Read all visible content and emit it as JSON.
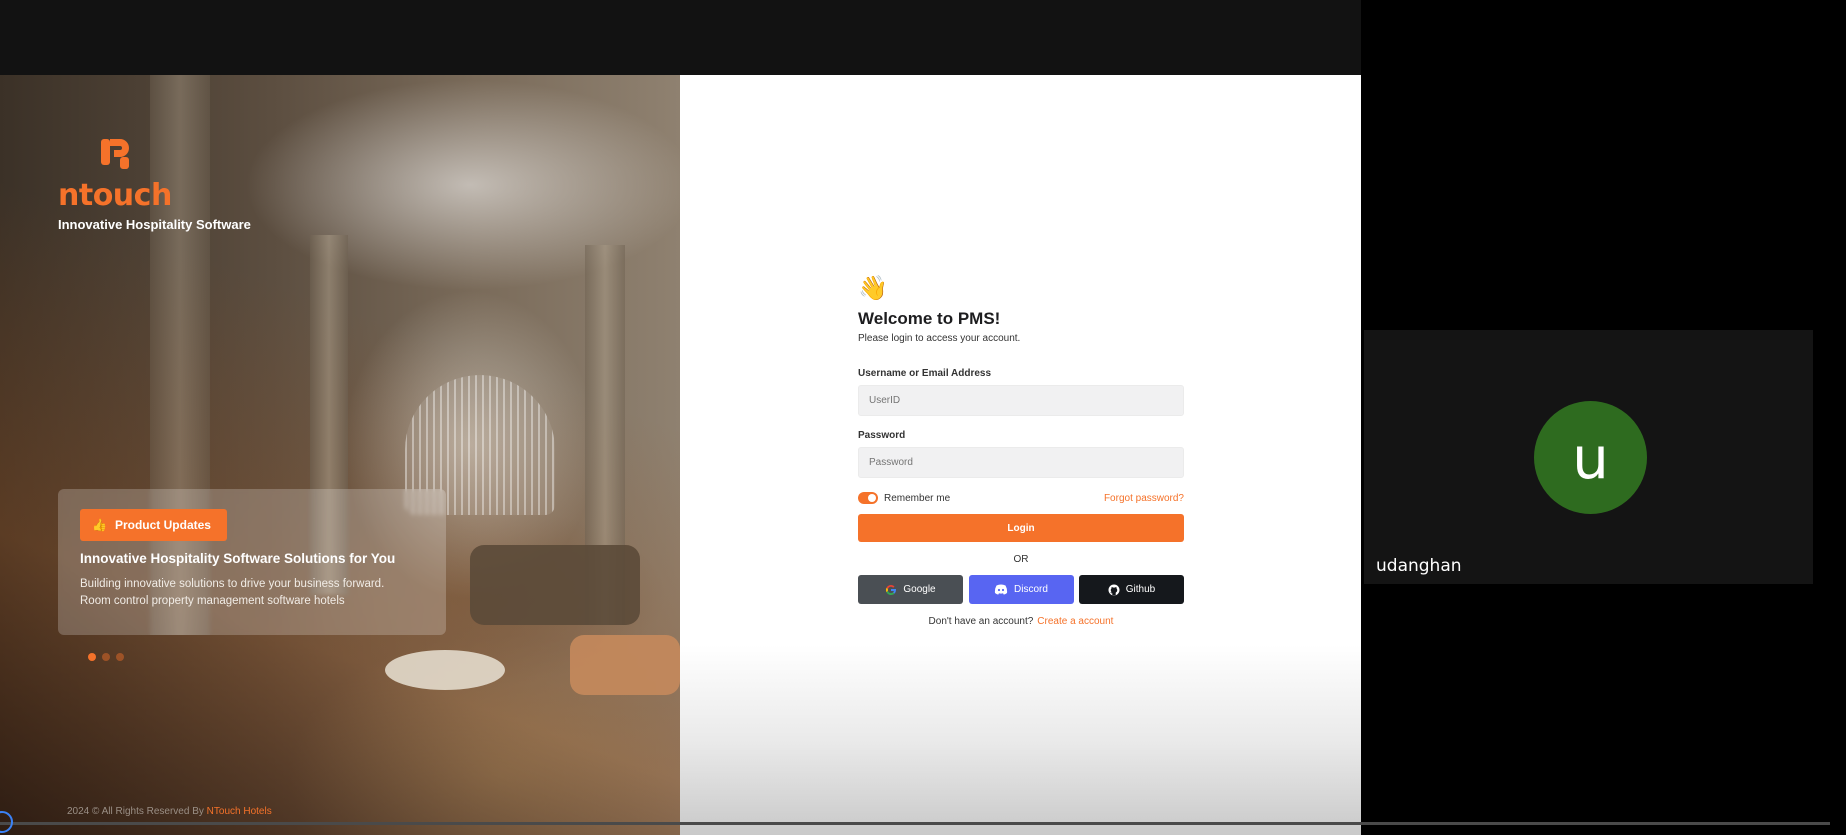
{
  "brand": {
    "name": "ntouch",
    "tagline": "Innovative Hospitality Software"
  },
  "update_card": {
    "badge": "Product Updates",
    "title": "Innovative Hospitality Software Solutions for You",
    "desc_line1": "Building innovative solutions to drive your business forward.",
    "desc_line2": "Room control  property management software hotels"
  },
  "carousel": {
    "count": 3,
    "active": 1
  },
  "footer": {
    "copyright": "2024 ©  All Rights Reserved By ",
    "company": "NTouch Hotels"
  },
  "login": {
    "wave": "👋",
    "title": "Welcome to PMS!",
    "subtitle": "Please login to access your account.",
    "username_label": "Username or Email Address",
    "username_placeholder": "UserID",
    "password_label": "Password",
    "password_placeholder": "Password",
    "remember_label": "Remember me",
    "remember_on": true,
    "forgot": "Forgot password?",
    "login_button": "Login",
    "or": "OR",
    "google": "Google",
    "discord": "Discord",
    "github": "Github",
    "no_account": "Don't have an account?",
    "create": "Create a account"
  },
  "participant": {
    "initial": "u",
    "name": "udanghan"
  },
  "colors": {
    "accent": "#f5722a",
    "discord": "#5865f2",
    "avatar": "#2e6b1f"
  }
}
